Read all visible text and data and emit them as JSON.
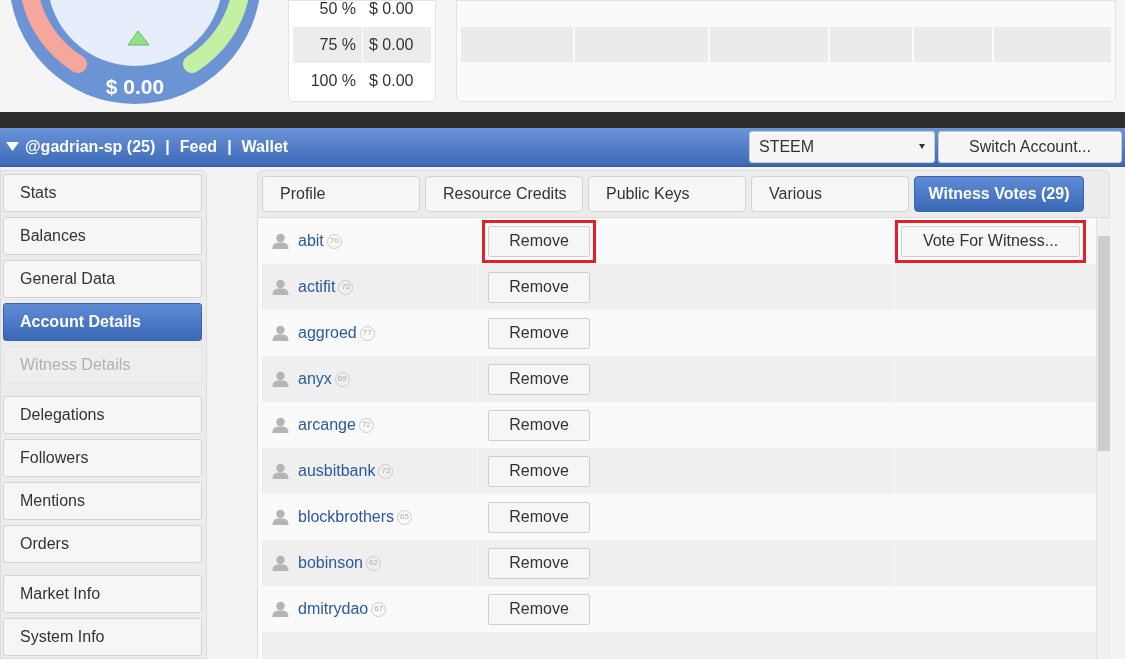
{
  "gauge": {
    "value": "$ 0.00"
  },
  "payout_table": {
    "rows": [
      {
        "percent": "50 %",
        "amount": "$ 0.00"
      },
      {
        "percent": "75 %",
        "amount": "$ 0.00"
      },
      {
        "percent": "100 %",
        "amount": "$ 0.00"
      }
    ]
  },
  "account_bar": {
    "title": "@gadrian-sp (25)",
    "separator": "|",
    "links": [
      "Feed",
      "Wallet"
    ],
    "currency": "STEEM",
    "switch_button": "Switch Account..."
  },
  "sidebar": {
    "groups": [
      [
        {
          "label": "Stats",
          "selected": false,
          "disabled": false
        },
        {
          "label": "Balances",
          "selected": false,
          "disabled": false
        },
        {
          "label": "General Data",
          "selected": false,
          "disabled": false
        },
        {
          "label": "Account Details",
          "selected": true,
          "disabled": false
        },
        {
          "label": "Witness Details",
          "selected": false,
          "disabled": true
        }
      ],
      [
        {
          "label": "Delegations",
          "selected": false,
          "disabled": false
        },
        {
          "label": "Followers",
          "selected": false,
          "disabled": false
        },
        {
          "label": "Mentions",
          "selected": false,
          "disabled": false
        },
        {
          "label": "Orders",
          "selected": false,
          "disabled": false
        }
      ],
      [
        {
          "label": "Market Info",
          "selected": false,
          "disabled": false
        },
        {
          "label": "System Info",
          "selected": false,
          "disabled": false
        }
      ]
    ]
  },
  "tabs": [
    {
      "label": "Profile",
      "selected": false
    },
    {
      "label": "Resource Credits",
      "selected": false
    },
    {
      "label": "Public Keys",
      "selected": false
    },
    {
      "label": "Various",
      "selected": false
    },
    {
      "label": "Witness Votes (29)",
      "selected": true
    }
  ],
  "witness_votes": {
    "vote_button": {
      "label": "Vote For Witness...",
      "highlighted": true
    },
    "rows": [
      {
        "name": "abit",
        "reputation": "70",
        "action": "Remove",
        "highlighted": true
      },
      {
        "name": "actifit",
        "reputation": "72",
        "action": "Remove",
        "highlighted": false
      },
      {
        "name": "aggroed",
        "reputation": "77",
        "action": "Remove",
        "highlighted": false
      },
      {
        "name": "anyx",
        "reputation": "69",
        "action": "Remove",
        "highlighted": false
      },
      {
        "name": "arcange",
        "reputation": "72",
        "action": "Remove",
        "highlighted": false
      },
      {
        "name": "ausbitbank",
        "reputation": "72",
        "action": "Remove",
        "highlighted": false
      },
      {
        "name": "blockbrothers",
        "reputation": "65",
        "action": "Remove",
        "highlighted": false
      },
      {
        "name": "bobinson",
        "reputation": "62",
        "action": "Remove",
        "highlighted": false
      },
      {
        "name": "dmitrydao",
        "reputation": "67",
        "action": "Remove",
        "highlighted": false
      }
    ]
  }
}
